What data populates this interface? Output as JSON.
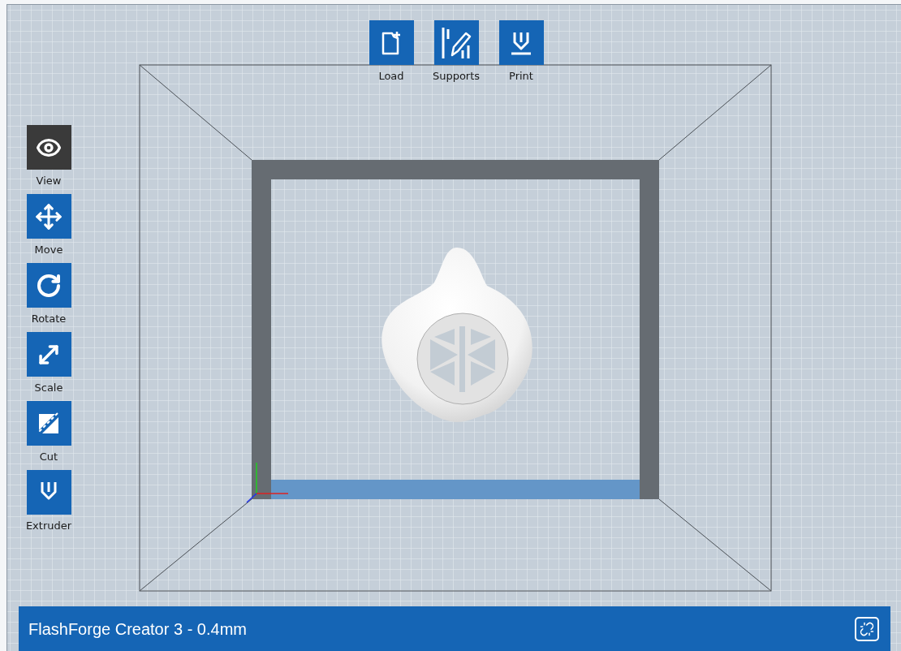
{
  "top_toolbar": [
    {
      "label": "Load",
      "kind": "load"
    },
    {
      "label": "Supports",
      "kind": "supports"
    },
    {
      "label": "Print",
      "kind": "print"
    }
  ],
  "side_toolbar": [
    {
      "label": "View",
      "kind": "view",
      "selected": true
    },
    {
      "label": "Move",
      "kind": "move",
      "selected": false
    },
    {
      "label": "Rotate",
      "kind": "rotate",
      "selected": false
    },
    {
      "label": "Scale",
      "kind": "scale",
      "selected": false
    },
    {
      "label": "Cut",
      "kind": "cut",
      "selected": false
    },
    {
      "label": "Extruder",
      "kind": "extruder",
      "selected": false
    }
  ],
  "status_bar": {
    "printer": "FlashForge Creator 3 - 0.4mm"
  }
}
